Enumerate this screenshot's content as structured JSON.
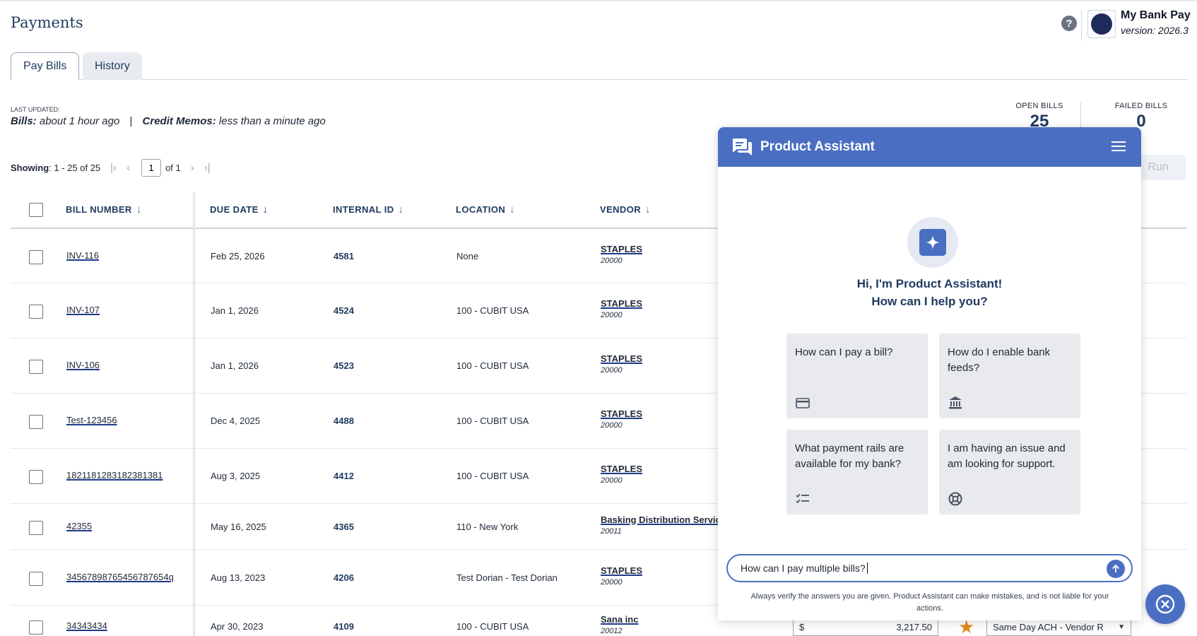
{
  "header": {
    "title": "Payments",
    "app_name": "My Bank Pay",
    "app_version": "version: 2026.3",
    "help_icon": "question-circle-icon"
  },
  "tabs": [
    {
      "label": "Pay Bills",
      "active": true
    },
    {
      "label": "History",
      "active": false
    }
  ],
  "last_updated": {
    "label": "LAST UPDATED:",
    "bills_label": "Bills:",
    "bills_value": "about 1 hour ago",
    "separator": "|",
    "memos_label": "Credit Memos:",
    "memos_value": "less than a minute ago"
  },
  "stats": {
    "open_label": "OPEN BILLS",
    "open_value": "25",
    "failed_label": "FAILED BILLS",
    "failed_value": "0"
  },
  "pager": {
    "showing_label": "Showing",
    "showing_value": ": 1 - 25 of 25",
    "page": "1",
    "of_label": "of 1"
  },
  "run_button": "Run",
  "table": {
    "columns": [
      "BILL NUMBER",
      "DUE DATE",
      "INTERNAL ID",
      "LOCATION",
      "VENDOR"
    ],
    "rows": [
      {
        "bill": "INV-116",
        "due": "Feb 25, 2026",
        "id": "4581",
        "location": "None",
        "vendor": "STAPLES",
        "vendor_code": "20000"
      },
      {
        "bill": "INV-107",
        "due": "Jan 1, 2026",
        "id": "4524",
        "location": "100 - CUBIT USA",
        "vendor": "STAPLES",
        "vendor_code": "20000"
      },
      {
        "bill": "INV-106",
        "due": "Jan 1, 2026",
        "id": "4523",
        "location": "100 - CUBIT USA",
        "vendor": "STAPLES",
        "vendor_code": "20000"
      },
      {
        "bill": "Test-123456",
        "due": "Dec 4, 2025",
        "id": "4488",
        "location": "100 - CUBIT USA",
        "vendor": "STAPLES",
        "vendor_code": "20000"
      },
      {
        "bill": "1821181283182381381",
        "due": "Aug 3, 2025",
        "id": "4412",
        "location": "100 - CUBIT USA",
        "vendor": "STAPLES",
        "vendor_code": "20000"
      },
      {
        "bill": "42355",
        "due": "May 16, 2025",
        "id": "4365",
        "location": "110 - New York",
        "vendor": "Basking Distribution Service",
        "vendor_code": "20011"
      },
      {
        "bill": "34567898765456787654q",
        "due": "Aug 13, 2023",
        "id": "4206",
        "location": "Test Dorian - Test Dorian",
        "vendor": "STAPLES",
        "vendor_code": "20000"
      },
      {
        "bill": "34343434",
        "due": "Apr 30, 2023",
        "id": "4109",
        "location": "100 - CUBIT USA",
        "vendor": "Sana inc",
        "vendor_code": "20012"
      }
    ]
  },
  "bottom_row": {
    "currency": "$",
    "amount": "3,217.50",
    "payment_rail": "Same Day ACH - Vendor R"
  },
  "assistant": {
    "title": "Product Assistant",
    "greeting_line1": "Hi, I'm Product Assistant!",
    "greeting_line2": "How can I help you?",
    "suggestions": [
      {
        "text": "How can I pay a bill?",
        "icon": "credit-card-icon"
      },
      {
        "text": "How do I enable bank feeds?",
        "icon": "bank-icon"
      },
      {
        "text": "What payment rails are available for my bank?",
        "icon": "checklist-icon"
      },
      {
        "text": "I am having an issue and am looking for support.",
        "icon": "lifebuoy-icon"
      }
    ],
    "input_value": "How can I pay multiple bills?",
    "disclaimer": "Always verify the answers you are given. Product Assistant can make mistakes, and is not liable for your actions."
  },
  "colors": {
    "accent": "#4a6fc2",
    "title": "#1e3a5f",
    "star": "#e08a1e"
  }
}
